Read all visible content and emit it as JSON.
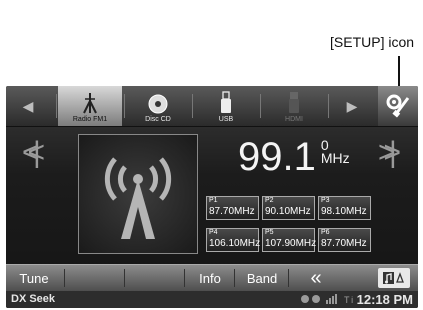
{
  "annotation": {
    "setup_label": "[SETUP] icon"
  },
  "sources": [
    {
      "label": "Radio FM1",
      "icon": "radio-antenna-icon",
      "state": "active"
    },
    {
      "label": "Disc CD",
      "icon": "disc-icon",
      "state": "normal"
    },
    {
      "label": "USB",
      "icon": "usb-icon",
      "state": "normal"
    },
    {
      "label": "HDMI",
      "icon": "hdmi-icon",
      "state": "disabled"
    }
  ],
  "tuner": {
    "frequency": "99.1",
    "frequency_mark": "0",
    "unit": "MHz",
    "presets": [
      {
        "id": "P1",
        "freq": "87.70MHz"
      },
      {
        "id": "P2",
        "freq": "90.10MHz"
      },
      {
        "id": "P3",
        "freq": "98.10MHz"
      },
      {
        "id": "P4",
        "freq": "106.10MHz"
      },
      {
        "id": "P5",
        "freq": "107.90MHz"
      },
      {
        "id": "P6",
        "freq": "87.70MHz"
      }
    ]
  },
  "bottom_bar": {
    "tune": "Tune",
    "info": "Info",
    "band": "Band",
    "back": "«"
  },
  "status": {
    "mode": "DX Seek",
    "time": "12:18 PM",
    "icons": "bt-icon bt-audio-icon signal-icon"
  }
}
